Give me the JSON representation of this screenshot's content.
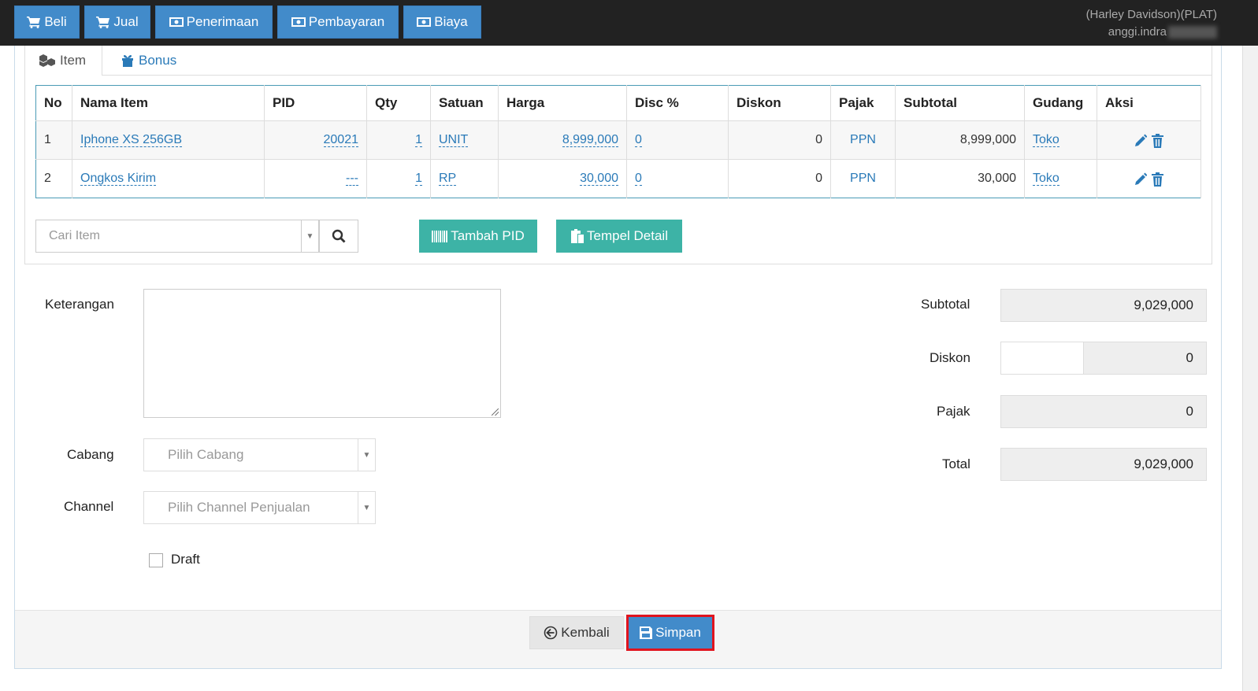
{
  "topnav": {
    "buttons": [
      {
        "label": "Beli",
        "icon": "cart-icon"
      },
      {
        "label": "Jual",
        "icon": "cart-icon"
      },
      {
        "label": "Penerimaan",
        "icon": "money-icon"
      },
      {
        "label": "Pembayaran",
        "icon": "money-icon"
      },
      {
        "label": "Biaya",
        "icon": "money-icon"
      }
    ],
    "company": "(Harley Davidson)(PLAT)",
    "user": "anggi.indra"
  },
  "tabs": [
    {
      "label": "Item",
      "active": true,
      "icon": "cubes-icon"
    },
    {
      "label": "Bonus",
      "active": false,
      "icon": "gift-icon"
    }
  ],
  "table": {
    "headers": [
      "No",
      "Nama Item",
      "PID",
      "Qty",
      "Satuan",
      "Harga",
      "Disc %",
      "Diskon",
      "Pajak",
      "Subtotal",
      "Gudang",
      "Aksi"
    ],
    "rows": [
      {
        "no": "1",
        "nama": "Iphone XS 256GB",
        "pid": "20021",
        "qty": "1",
        "satuan": "UNIT",
        "harga": "8,999,000",
        "disc": "0",
        "diskon": "0",
        "pajak": "PPN",
        "subtotal": "8,999,000",
        "gudang": "Toko"
      },
      {
        "no": "2",
        "nama": "Ongkos Kirim",
        "pid": "---",
        "qty": "1",
        "satuan": "RP",
        "harga": "30,000",
        "disc": "0",
        "diskon": "0",
        "pajak": "PPN",
        "subtotal": "30,000",
        "gudang": "Toko"
      }
    ]
  },
  "search": {
    "placeholder": "Cari Item"
  },
  "actions": {
    "tambah_pid": "Tambah PID",
    "tempel_detail": "Tempel Detail"
  },
  "form": {
    "keterangan_label": "Keterangan",
    "cabang_label": "Cabang",
    "cabang_placeholder": "Pilih Cabang",
    "channel_label": "Channel",
    "channel_placeholder": "Pilih Channel Penjualan",
    "draft_label": "Draft"
  },
  "summary": {
    "subtotal_label": "Subtotal",
    "subtotal": "9,029,000",
    "diskon_label": "Diskon",
    "diskon": "0",
    "pajak_label": "Pajak",
    "pajak": "0",
    "total_label": "Total",
    "total": "9,029,000"
  },
  "footer": {
    "kembali": "Kembali",
    "simpan": "Simpan"
  },
  "colors": {
    "primary": "#428bca",
    "teal": "#3db3a6",
    "topbar": "#222222",
    "highlight": "#e0141e"
  }
}
